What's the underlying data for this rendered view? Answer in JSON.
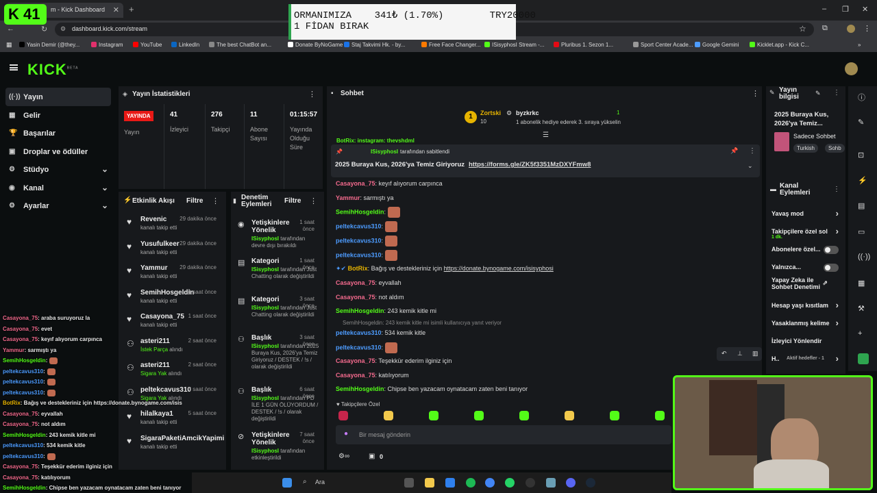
{
  "browser": {
    "tab_title": "m - Kick Dashboard",
    "url": "dashboard.kick.com/stream",
    "bookmarks": [
      {
        "label": "Yasin Demir (@they...",
        "color": "#000000"
      },
      {
        "label": "Instagram",
        "color": "#e1306c"
      },
      {
        "label": "YouTube",
        "color": "#ff0000"
      },
      {
        "label": "LinkedIn",
        "color": "#0a66c2"
      },
      {
        "label": "The best ChatBot an...",
        "color": "#888888"
      },
      {
        "label": "Donate ByNoGame",
        "color": "#ffffff"
      },
      {
        "label": "Staj Takvimi Hk. - by...",
        "color": "#1a73e8"
      },
      {
        "label": "Free Face Changer...",
        "color": "#ff7a00"
      },
      {
        "label": "ISisyphosI Stream -...",
        "color": "#53fc18"
      },
      {
        "label": "Pluribus 1. Sezon 1...",
        "color": "#e50914"
      },
      {
        "label": "Sport Center Acade...",
        "color": "#999999"
      },
      {
        "label": "Google Gemini",
        "color": "#4d9cff"
      },
      {
        "label": "Kicklet.app - Kick C...",
        "color": "#53fc18"
      }
    ]
  },
  "overlay_badge": {
    "text": "K 41"
  },
  "ad_banner": {
    "line1": "ORMANIMIZA    341₺ (1.70%)        TRY20000",
    "line2": "1 FİDAN BIRAK"
  },
  "brand": {
    "logo": "KICK",
    "beta": "BETA",
    "accent": "#53fc18"
  },
  "nav": {
    "items": [
      {
        "label": "Yayın",
        "icon": "broadcast-icon"
      },
      {
        "label": "Gelir",
        "icon": "wallet-icon"
      },
      {
        "label": "Başarılar",
        "icon": "trophy-icon"
      },
      {
        "label": "Droplar ve ödüller",
        "icon": "gift-icon"
      },
      {
        "label": "Stüdyo",
        "icon": "studio-icon"
      },
      {
        "label": "Kanal",
        "icon": "channel-icon"
      },
      {
        "label": "Ayarlar",
        "icon": "gear-icon"
      }
    ]
  },
  "stats": {
    "title": "Yayın İstatistikleri",
    "live_badge": "YAYINDA",
    "live_label": "Yayın",
    "viewers": "41",
    "viewers_label": "İzleyici",
    "followers": "276",
    "followers_label": "Takipçi",
    "subs": "11",
    "subs_label": "Abone Sayısı",
    "duration": "01:15:57",
    "duration_label": "Yayında Olduğu Süre"
  },
  "activity": {
    "title": "Etkinlik Akışı",
    "filter": "Filtre",
    "items": [
      {
        "name": "Revenic",
        "time": "29 dakika önce",
        "desc": "kanalı takip etti",
        "extra": ""
      },
      {
        "name": "Yusufulkeer",
        "time": "29 dakika önce",
        "desc": "kanalı takip etti",
        "extra": ""
      },
      {
        "name": "Yammur",
        "time": "29 dakika önce",
        "desc": "kanalı takip etti",
        "extra": ""
      },
      {
        "name": "SemihHosgeldin",
        "time": "1 saat önce",
        "desc": "kanalı takip etti",
        "extra": ""
      },
      {
        "name": "Casayona_75",
        "time": "1 saat önce",
        "desc": "kanalı takip etti",
        "extra": ""
      },
      {
        "name": "asteri211",
        "time": "2 saat önce",
        "desc": "alındı",
        "extra": "İstek Parça"
      },
      {
        "name": "asteri211",
        "time": "2 saat önce",
        "desc": "alındı",
        "extra": "Sigara Yak"
      },
      {
        "name": "peltekcavus310",
        "time": "3 saat önce",
        "desc": "alındı",
        "extra": "Sigara Yak"
      },
      {
        "name": "hilalkaya1",
        "time": "5 saat önce",
        "desc": "kanalı takip etti",
        "extra": ""
      },
      {
        "name": "SigaraPaketiAmcikYapimi",
        "time": "",
        "desc": "kanalı takip etti",
        "extra": ""
      }
    ]
  },
  "moderation": {
    "title": "Denetim Eylemleri",
    "filter": "Filtre",
    "items": [
      {
        "name": "Yetişkinlere Yönelik",
        "time": "1 saat önce",
        "user": "ISisyphosI",
        "desc": "tarafından devre dışı bırakıldı",
        "icon": "eye-icon"
      },
      {
        "name": "Kategori",
        "time": "1 saat önce",
        "user": "ISisyphosI",
        "desc": "tarafından Just Chatting olarak değiştirildi",
        "icon": "category-icon"
      },
      {
        "name": "Kategori",
        "time": "3 saat önce",
        "user": "ISisyphosI",
        "desc": "tarafından Just Chatting olarak değiştirildi",
        "icon": "category-icon"
      },
      {
        "name": "Başlık",
        "time": "3 saat önce",
        "user": "ISisyphosI",
        "desc": "tarafından 2025 Buraya Kus, 2026'ya Temiz Giriyoruz / DESTEK / !s / olarak değiştirildi",
        "icon": "title-icon"
      },
      {
        "name": "Başlık",
        "time": "6 saat önce",
        "user": "ISisyphosI",
        "desc": "tarafından PD İLE 1 GÜN ÖLÜYORDUM / DESTEK / !s / olarak değiştirildi",
        "icon": "title-icon"
      },
      {
        "name": "Yetişkinlere Yönelik",
        "time": "7 saat önce",
        "user": "ISisyphosI",
        "desc": "tarafından etkinleştirildi",
        "icon": "eye-off-icon"
      }
    ]
  },
  "chat": {
    "title": "Sohbet",
    "top_gifter": {
      "name": "Zortski",
      "count": "10"
    },
    "gift_banner": {
      "user": "byzkrkc",
      "text": "1 abonelik hediye ederek 3. sıraya yükselin",
      "count": "1"
    },
    "pinned": {
      "by": "ISisyphosI",
      "label": "tarafından sabitlendi",
      "text": "2025 Buraya Kus, 2026'ya Temiz Giriyoruz",
      "link": "https://forms.gle/ZK5f3351MzDXYFmw8"
    },
    "partial_top": "BotRix: instagram: thevshdml",
    "messages": [
      {
        "user": "Casayona_75",
        "color": "pink",
        "text": "keyıf alıyorum carpınca"
      },
      {
        "user": "Yammur",
        "color": "pink",
        "text": "sarmıştı ya"
      },
      {
        "user": "SemihHosgeldin",
        "color": "green",
        "text": "",
        "emote": true
      },
      {
        "user": "peltekcavus310",
        "color": "blue",
        "text": "",
        "emote": true
      },
      {
        "user": "peltekcavus310",
        "color": "blue",
        "text": "",
        "emote": true
      },
      {
        "user": "peltekcavus310",
        "color": "blue",
        "text": "",
        "emote": true
      },
      {
        "user": "BotRix",
        "color": "gold",
        "text": "Bağış ve destekleriniz için ",
        "link": "https://donate.bynogame.com/isisyphosi"
      },
      {
        "user": "Casayona_75",
        "color": "pink",
        "text": "eyvallah"
      },
      {
        "user": "Casayona_75",
        "color": "pink",
        "text": "not aldım"
      },
      {
        "user": "SemihHosgeldin",
        "color": "green",
        "text": "243 kemik kitle mi"
      },
      {
        "user": "peltekcavus310",
        "color": "blue",
        "text": "534 kemik kitle",
        "reply": "SemihHosgeldin: 243 kemik kitle mi isimli kullanıcıya yanıt veriyor"
      },
      {
        "user": "peltekcavus310",
        "color": "blue",
        "text": "",
        "emote": true
      },
      {
        "user": "Casayona_75",
        "color": "pink",
        "text": "Teşekkür ederim ilginiz için"
      },
      {
        "user": "Casayona_75",
        "color": "pink",
        "text": "katılıyorum"
      },
      {
        "user": "SemihHosgeldin",
        "color": "green",
        "text": "Chipse ben yazacam oynatacam zaten beni tanıyor"
      }
    ],
    "followers_only": "Takipçilere Özel",
    "input_placeholder": "Bir mesaj gönderin",
    "footer_count": "0"
  },
  "stream_info": {
    "title": "Yayın bilgisi",
    "stream_title": "2025 Buraya Kus, 2026'ya Temiz...",
    "category": "Sadece Sohbet",
    "tags": [
      "Turkish",
      "Sohb"
    ]
  },
  "channel_actions": {
    "title": "Kanal Eylemleri",
    "items": [
      {
        "label": "Yavaş mod",
        "type": "arrow",
        "sub": ""
      },
      {
        "label": "Takipçilere özel sol",
        "type": "arrow",
        "sub": "1 dk."
      },
      {
        "label": "Abonelere özel...",
        "type": "toggle",
        "sub": ""
      },
      {
        "label": "Yalnızca...",
        "type": "toggle",
        "sub": ""
      },
      {
        "label": "Yapay Zeka ile Sohbet Denetimi",
        "type": "ext",
        "sub": ""
      },
      {
        "label": "Hesap yaşı kısıtlam",
        "type": "arrow",
        "sub": ""
      },
      {
        "label": "Yasaklanmış kelime",
        "type": "arrow",
        "sub": ""
      },
      {
        "label": "İzleyici Yönlendir",
        "type": "none",
        "sub": ""
      },
      {
        "label": "H..",
        "type": "arrow",
        "sub": "Aktif hedefler - 1"
      }
    ]
  },
  "stream_overlay_chat": [
    {
      "user": "Casayona_75",
      "text": ": araba suruyoruz la",
      "color": "#f36a8d"
    },
    {
      "user": "Casayona_75",
      "text": ": evet",
      "color": "#f36a8d"
    },
    {
      "user": "Casayona_75",
      "text": ": keyıf alıyorum carpınca",
      "color": "#f36a8d"
    },
    {
      "user": "Yammur",
      "text": ": sarmıştı ya",
      "color": "#f36a8d"
    },
    {
      "user": "SemihHosgeldin",
      "text": ":",
      "color": "#53fc18"
    },
    {
      "user": "peltekcavus310",
      "text": ":",
      "color": "#4d9cff"
    },
    {
      "user": "peltekcavus310",
      "text": ":",
      "color": "#4d9cff"
    },
    {
      "user": "peltekcavus310",
      "text": ":",
      "color": "#4d9cff"
    },
    {
      "user": "BotRix",
      "text": ": Bağış ve destekleriniz için https://donate.bynogame.com/isis",
      "color": "#e6b300"
    },
    {
      "user": "Casayona_75",
      "text": ": eyvallah",
      "color": "#f36a8d"
    },
    {
      "user": "Casayona_75",
      "text": ": not aldım",
      "color": "#f36a8d"
    },
    {
      "user": "SemihHosgeldin",
      "text": ": 243 kemik kitle mi",
      "color": "#53fc18"
    },
    {
      "user": "peltekcavus310",
      "text": ": 534 kemik kitle",
      "color": "#4d9cff"
    },
    {
      "user": "peltekcavus310",
      "text": ":",
      "color": "#4d9cff"
    },
    {
      "user": "Casayona_75",
      "text": ": Teşekkür ederim ilginiz için",
      "color": "#f36a8d"
    },
    {
      "user": "Casayona_75",
      "text": ": katılıyorum",
      "color": "#f36a8d"
    },
    {
      "user": "SemihHosgeldin",
      "text": ": Chipse ben yazacam oynatacam zaten beni tanıyor",
      "color": "#53fc18"
    }
  ],
  "taskbar": {
    "search": "Ara"
  }
}
